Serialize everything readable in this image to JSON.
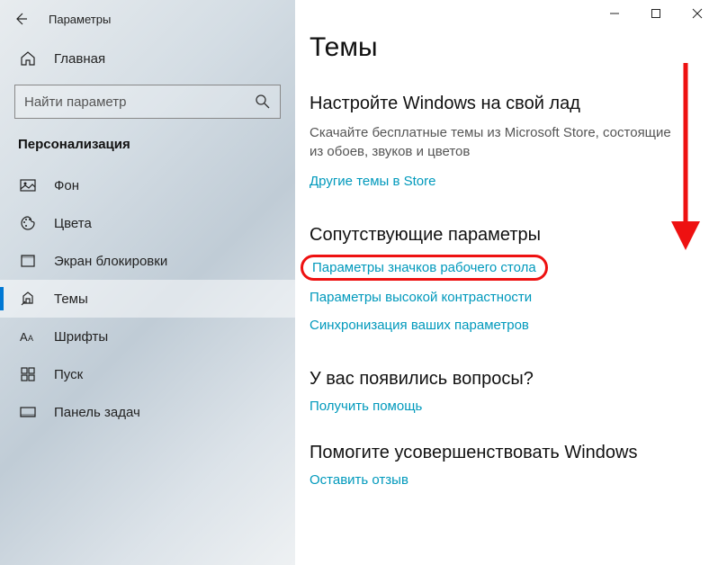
{
  "window": {
    "title": "Параметры"
  },
  "sidebar": {
    "home": "Главная",
    "search_placeholder": "Найти параметр",
    "section": "Персонализация",
    "items": [
      {
        "label": "Фон"
      },
      {
        "label": "Цвета"
      },
      {
        "label": "Экран блокировки"
      },
      {
        "label": "Темы"
      },
      {
        "label": "Шрифты"
      },
      {
        "label": "Пуск"
      },
      {
        "label": "Панель задач"
      }
    ]
  },
  "content": {
    "title": "Темы",
    "customize": {
      "heading": "Настройте Windows на свой лад",
      "desc": "Скачайте бесплатные темы из Microsoft Store, состоящие из обоев, звуков и цветов",
      "store_link": "Другие темы в Store"
    },
    "related": {
      "heading": "Сопутствующие параметры",
      "link_icons": "Параметры значков рабочего стола",
      "link_contrast": "Параметры высокой контрастности",
      "link_sync": "Синхронизация ваших параметров"
    },
    "help": {
      "heading": "У вас появились вопросы?",
      "link": "Получить помощь"
    },
    "feedback": {
      "heading": "Помогите усовершенствовать Windows",
      "link": "Оставить отзыв"
    }
  }
}
